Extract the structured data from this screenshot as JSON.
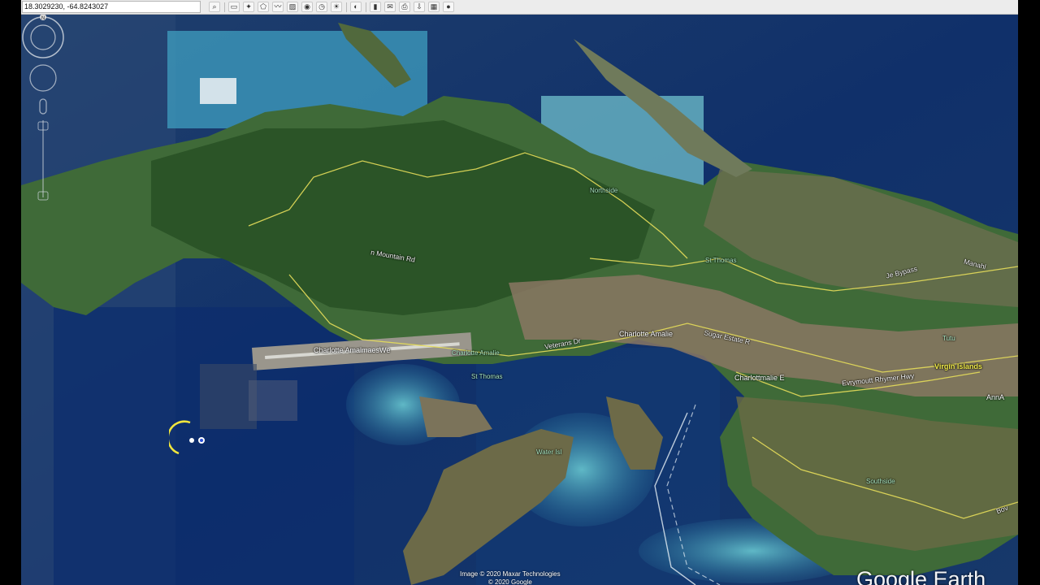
{
  "toolbar": {
    "coordinates": "18.3029230, -64.8243027",
    "buttons": [
      {
        "icon": "search-icon",
        "glyph": "⌕"
      },
      {
        "icon": "sidebar-icon",
        "glyph": "▭"
      },
      {
        "icon": "placemark-icon",
        "glyph": "✦"
      },
      {
        "icon": "polygon-icon",
        "glyph": "⬠"
      },
      {
        "icon": "path-icon",
        "glyph": "〰"
      },
      {
        "icon": "overlay-icon",
        "glyph": "▨"
      },
      {
        "icon": "tour-icon",
        "glyph": "◉"
      },
      {
        "icon": "historical-imagery-icon",
        "glyph": "◷"
      },
      {
        "icon": "sunlight-icon",
        "glyph": "☀"
      },
      {
        "icon": "planets-icon",
        "glyph": "◐"
      },
      {
        "icon": "ruler-icon",
        "glyph": "▮"
      },
      {
        "icon": "email-icon",
        "glyph": "✉"
      },
      {
        "icon": "print-icon",
        "glyph": "⎙"
      },
      {
        "icon": "save-image-icon",
        "glyph": "⇩"
      },
      {
        "icon": "maps-icon",
        "glyph": "▦"
      },
      {
        "icon": "earth-icon",
        "glyph": "●"
      }
    ]
  },
  "map": {
    "labels": {
      "charlotte_amalie_1": "Charlotte Amalie",
      "charlotte_amalie_west": "Charlotte AmalmaesWe",
      "charlotte_amalie_small": "Charlotte Amalie",
      "st_thomas": "St Thomas",
      "st_thomas_2": "St Thomas",
      "northside": "Northside",
      "southside": "Southside",
      "water_island": "Water Isl",
      "virgin_islands": "Virgin Islands",
      "ann": "AnnA",
      "charlotte_e": "Charlottmalie E",
      "tutu": "Tutu",
      "crown_mountain_rd": "n Mountain Rd",
      "sugar_estate": "Sugar Estate R",
      "veterans": "Veterans Dr",
      "bypass": "Je Bypass",
      "mandahl": "Manahl",
      "raymond": "Evrymoutt Rhymer Hwy",
      "bovoni": "Bov"
    },
    "credits_line1": "Image © 2020 Maxar Technologies",
    "credits_line2": "© 2020 Google",
    "brand": "Google Earth"
  },
  "navigation": {
    "north_label": "N"
  }
}
